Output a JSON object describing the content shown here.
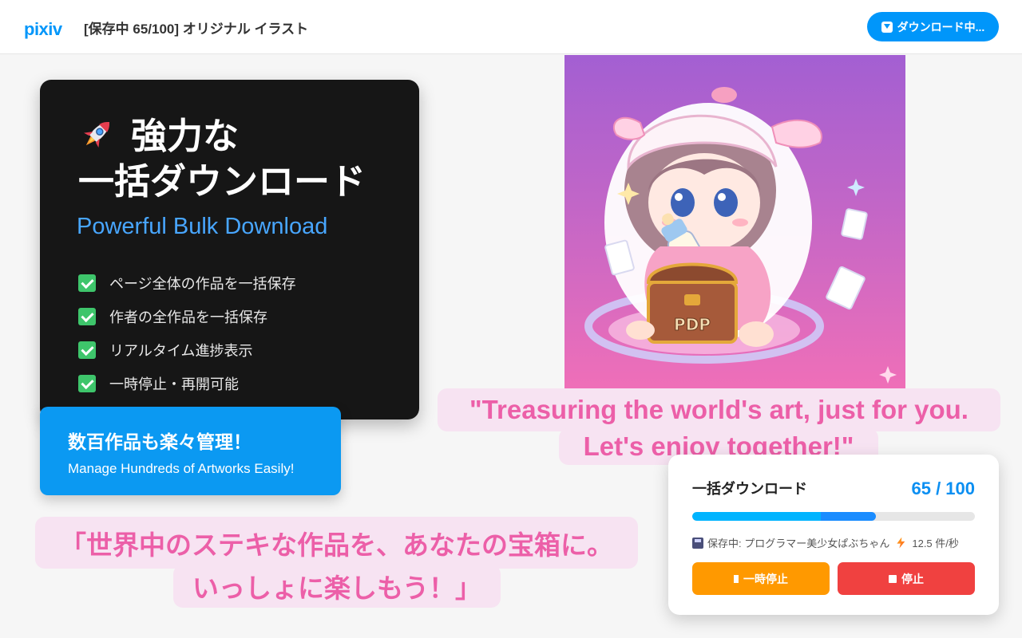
{
  "header": {
    "logo": "pixiv",
    "title": "[保存中 65/100] オリジナル イラスト",
    "download_button": "ダウンロード中..."
  },
  "feature_card": {
    "title_line1": "強力な",
    "title_line2": "一括ダウンロード",
    "subtitle": "Powerful Bulk Download",
    "items": [
      "ページ全体の作品を一括保存",
      "作者の全作品を一括保存",
      "リアルタイム進捗表示",
      "一時停止・再開可能"
    ]
  },
  "manage_card": {
    "title": "数百作品も楽々管理！",
    "subtitle": "Manage Hundreds of Artworks Easily!"
  },
  "jp_quote": {
    "line1": "「世界中のステキな作品を、あなたの宝箱に。",
    "line2": "いっしょに楽しもう！」"
  },
  "en_quote": {
    "line1": "\"Treasuring the world's art, just for you.",
    "line2": "Let's enjoy together!\""
  },
  "artwork": {
    "chest_label": "PDP"
  },
  "progress_card": {
    "title": "一括ダウンロード",
    "count": "65 / 100",
    "progress": 0.65,
    "status": "保存中: プログラマー美少女ぱぶちゃん",
    "speed": "12.5 件/秒",
    "pause_label": "一時停止",
    "stop_label": "停止"
  },
  "colors": {
    "accent": "#0096fa",
    "pink": "#ec5fa8",
    "pause": "#ff9900",
    "stop": "#f04140",
    "check": "#3ec56b"
  }
}
